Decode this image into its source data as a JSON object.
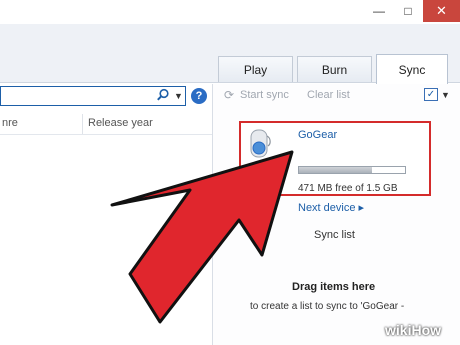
{
  "window": {
    "minimize_glyph": "—",
    "maximize_glyph": "□",
    "close_glyph": "✕"
  },
  "tabs": [
    {
      "label": "Play"
    },
    {
      "label": "Burn"
    },
    {
      "label": "Sync",
      "selected": true
    }
  ],
  "library": {
    "columns": [
      "nre",
      "Release year"
    ]
  },
  "sync_toolbar": {
    "start_sync": "Start sync",
    "clear_list": "Clear list"
  },
  "device": {
    "name": "GoGear",
    "capacity_used_fraction": 0.69,
    "free_text": "471 MB free of 1.5 GB"
  },
  "next_device_label": "Next device",
  "next_device_chevron": "▸",
  "sync_list": {
    "title": "Sync list",
    "drag_title": "Drag items here",
    "drag_subtitle": "to create a list to sync to 'GoGear -"
  },
  "watermark": "wikiHow",
  "colors": {
    "accent": "#1d5fa8",
    "highlight_box": "#d42b2b",
    "arrow": "#e0262d",
    "close_button": "#c9463d"
  }
}
